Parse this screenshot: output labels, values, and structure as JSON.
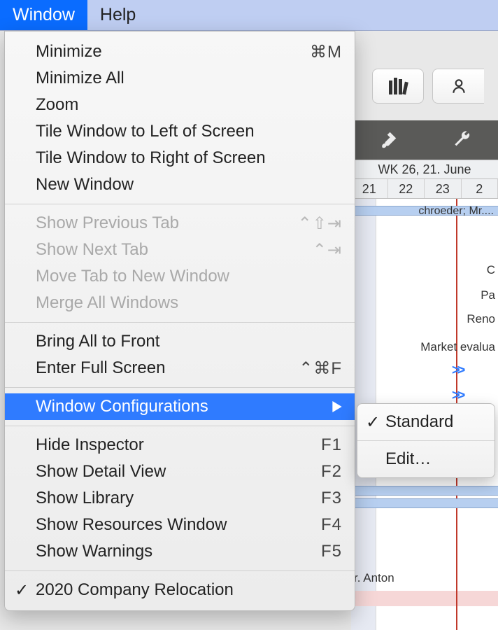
{
  "menubar": {
    "window": "Window",
    "help": "Help"
  },
  "dropdown": {
    "minimize": "Minimize",
    "minimize_sc": "⌘M",
    "minimize_all": "Minimize All",
    "zoom": "Zoom",
    "tile_left": "Tile Window to Left of Screen",
    "tile_right": "Tile Window to Right of Screen",
    "new_window": "New Window",
    "show_prev_tab": "Show Previous Tab",
    "show_prev_tab_sc": "⌃⇧⇥",
    "show_next_tab": "Show Next Tab",
    "show_next_tab_sc": "⌃⇥",
    "move_tab_new": "Move Tab to New Window",
    "merge_all": "Merge All Windows",
    "bring_front": "Bring All to Front",
    "enter_fs": "Enter Full Screen",
    "enter_fs_sc": "⌃⌘F",
    "window_conf": "Window Configurations",
    "hide_inspector": "Hide Inspector",
    "hide_inspector_sc": "F1",
    "show_detail": "Show Detail View",
    "show_detail_sc": "F2",
    "show_library": "Show Library",
    "show_library_sc": "F3",
    "show_resources": "Show Resources Window",
    "show_resources_sc": "F4",
    "show_warnings": "Show Warnings",
    "show_warnings_sc": "F5",
    "doc_name": "2020 Company Relocation"
  },
  "submenu": {
    "standard": "Standard",
    "edit": "Edit…"
  },
  "timeline": {
    "week_label": "WK 26, 21. June",
    "d21": "21",
    "d22": "22",
    "d23": "23",
    "t_schroeder": "chroeder; Mr....",
    "t_pa": "Pa",
    "t_reno": "Reno",
    "t_market": "Market evalua",
    "t_anton": "r. Anton"
  }
}
